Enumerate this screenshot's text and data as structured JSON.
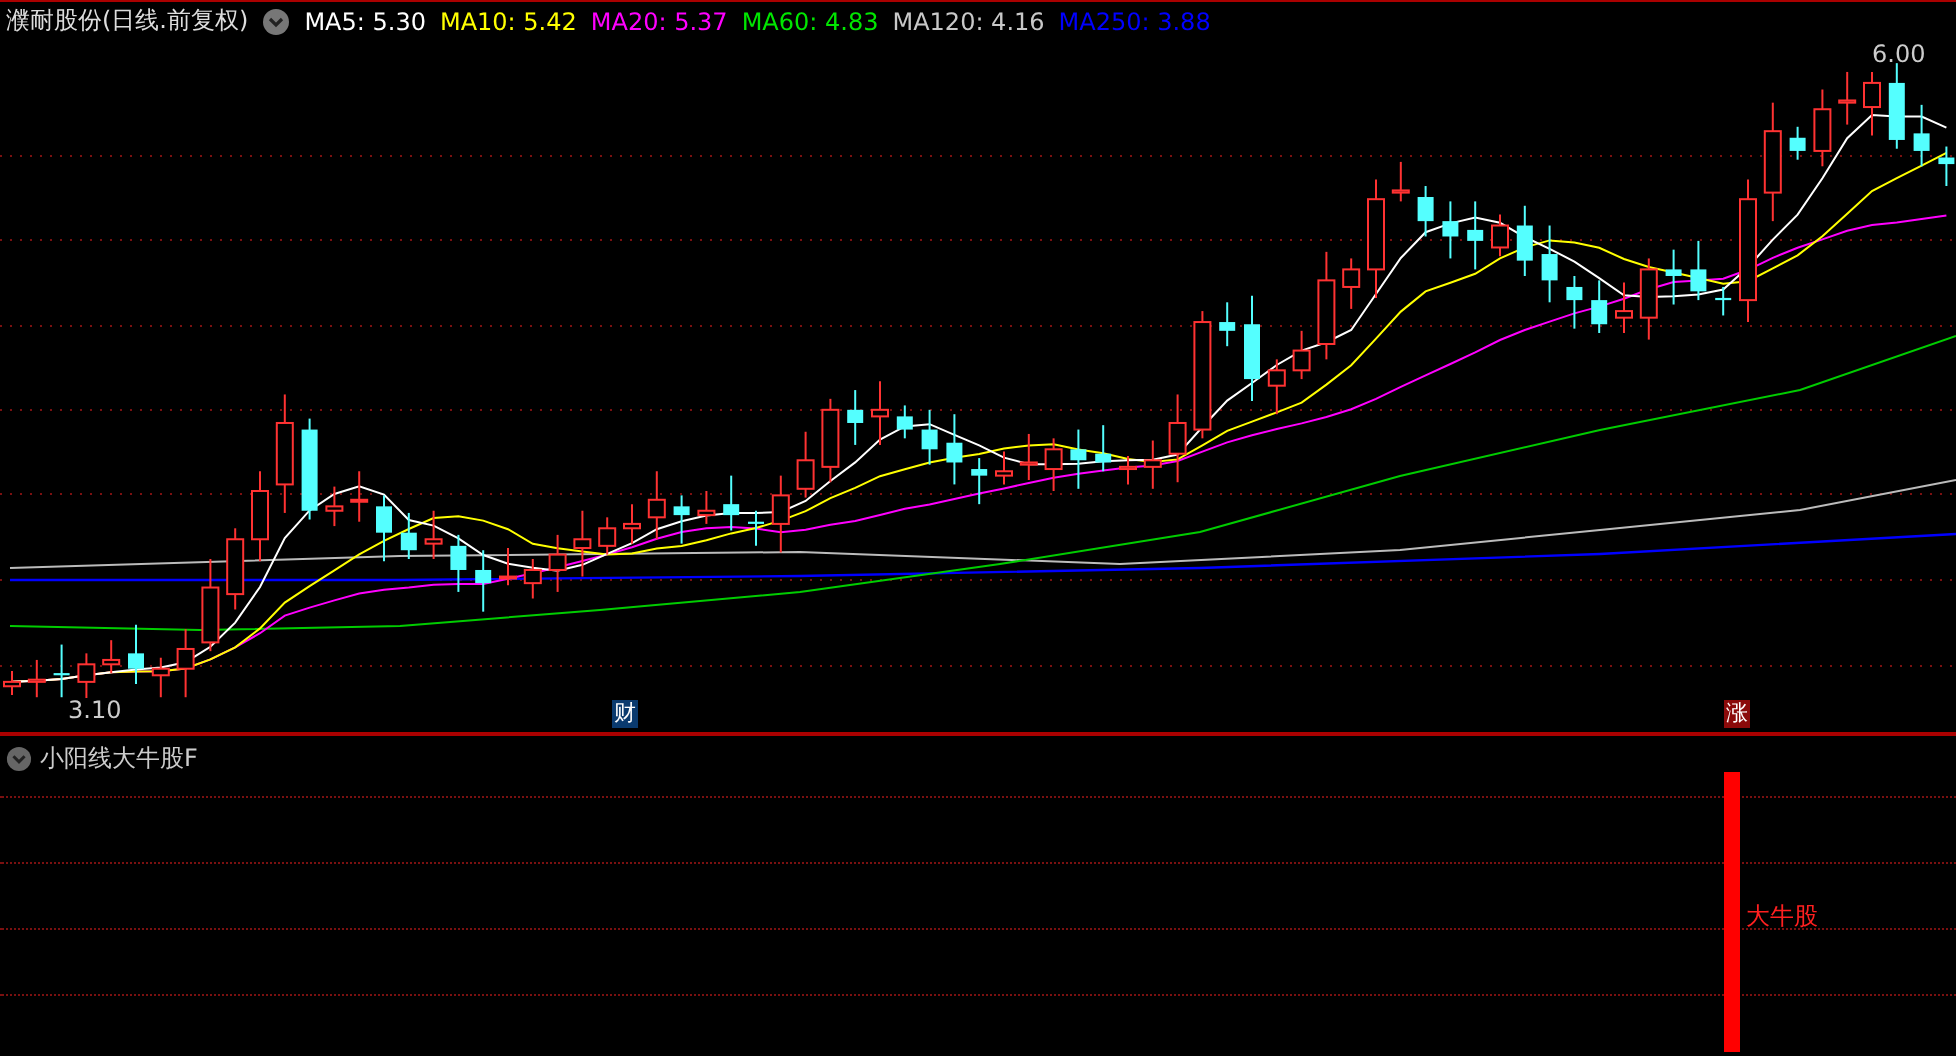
{
  "header": {
    "title": "濮耐股份(日线.前复权)",
    "indicators": [
      {
        "label": "MA5:",
        "value": "5.30",
        "color": "#ffffff"
      },
      {
        "label": "MA10:",
        "value": "5.42",
        "color": "#ffff00"
      },
      {
        "label": "MA20:",
        "value": "5.37",
        "color": "#ff00ff"
      },
      {
        "label": "MA60:",
        "value": "4.83",
        "color": "#00e600"
      },
      {
        "label": "MA120:",
        "value": "4.16",
        "color": "#c8c8c8"
      },
      {
        "label": "MA250:",
        "value": "3.88",
        "color": "#0000ff"
      }
    ]
  },
  "price_chart": {
    "high_label": "6.00",
    "low_label": "3.10",
    "badges": [
      {
        "text": "财",
        "color": "#0a3a6e"
      },
      {
        "text": "涨",
        "color": "#8b0a0a"
      }
    ]
  },
  "indicator_panel": {
    "title": "小阳线大牛股F",
    "signal_label": "大牛股"
  }
}
